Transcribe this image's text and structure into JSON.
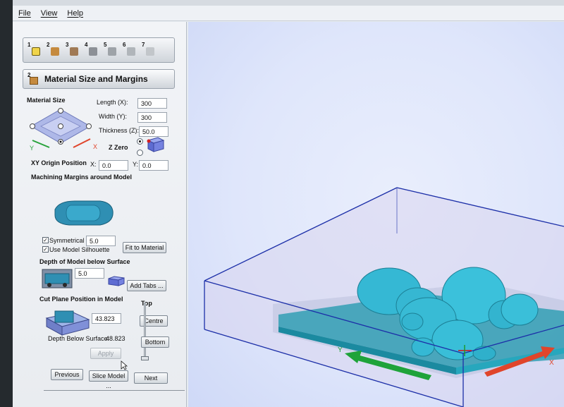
{
  "menu": {
    "file": "File",
    "view": "View",
    "help": "Help"
  },
  "steps": [
    "1",
    "2",
    "3",
    "4",
    "5",
    "6",
    "7"
  ],
  "section": {
    "number": "2",
    "title": "Material Size and Margins"
  },
  "material": {
    "heading": "Material Size",
    "length_label": "Length (X):",
    "length_value": "300",
    "width_label": "Width (Y):",
    "width_value": "300",
    "thickness_label": "Thickness (Z):",
    "thickness_value": "50.0",
    "zzero_label": "Z Zero",
    "axis_y": "Y",
    "axis_x": "X"
  },
  "origin": {
    "label": "XY Origin Position",
    "x_label": "X:",
    "x_value": "0.0",
    "y_label": "Y:",
    "y_value": "0.0"
  },
  "margins": {
    "heading": "Machining Margins around Model",
    "symmetrical_label": "Symmetrical",
    "symmetrical_checked": true,
    "symmetrical_value": "5.0",
    "silhouette_label": "Use Model Silhouette",
    "silhouette_checked": true,
    "fit_button": "Fit to Material"
  },
  "depth": {
    "heading": "Depth of Model below Surface",
    "value": "5.0",
    "add_tabs_button": "Add Tabs ..."
  },
  "cutplane": {
    "heading": "Cut Plane Position in Model",
    "top_label": "Top",
    "value": "43.823",
    "centre_button": "Centre",
    "depth_below_label": "Depth Below Surface:",
    "depth_below_value": "48.823",
    "bottom_button": "Bottom",
    "apply_button": "Apply"
  },
  "nav": {
    "previous": "Previous",
    "slice": "Slice Model ...",
    "next": "Next"
  },
  "viewport": {
    "axis_y": "Y",
    "axis_x": "X"
  },
  "colors": {
    "model": "#35b8d4",
    "slab": "#2aa8c0",
    "x_arrow": "#e0452b",
    "y_arrow": "#22a83a",
    "bbox": "#1c2fa8",
    "viewport_bg": "#dfe6fb"
  }
}
